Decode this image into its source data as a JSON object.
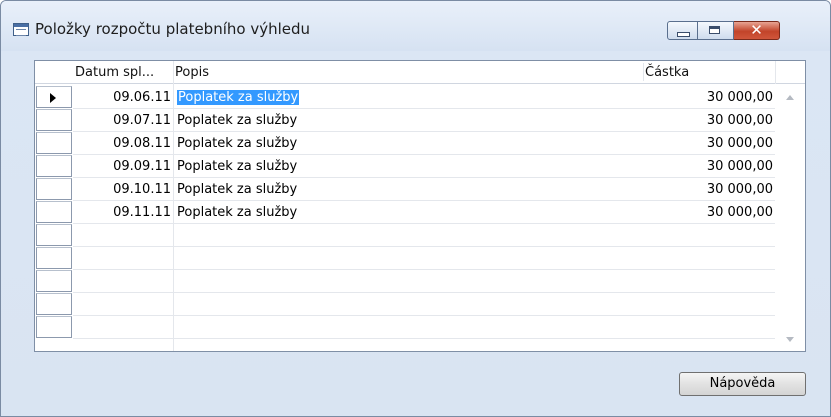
{
  "window": {
    "title": "Položky rozpočtu platebního výhledu"
  },
  "grid": {
    "columns": [
      "Datum spl...",
      "Popis",
      "Částka"
    ],
    "rows": [
      {
        "date": "09.06.11",
        "desc": "Poplatek za služby",
        "amount": "30 000,00"
      },
      {
        "date": "09.07.11",
        "desc": "Poplatek za služby",
        "amount": "30 000,00"
      },
      {
        "date": "09.08.11",
        "desc": "Poplatek za služby",
        "amount": "30 000,00"
      },
      {
        "date": "09.09.11",
        "desc": "Poplatek za služby",
        "amount": "30 000,00"
      },
      {
        "date": "09.10.11",
        "desc": "Poplatek za služby",
        "amount": "30 000,00"
      },
      {
        "date": "09.11.11",
        "desc": "Poplatek za služby",
        "amount": "30 000,00"
      }
    ],
    "empty_rows": 5,
    "selected_row": 0
  },
  "buttons": {
    "help": "Nápověda"
  },
  "icons": {
    "window": "list-window-icon",
    "minimize": "minimize-icon",
    "maximize": "maximize-icon",
    "close": "close-icon",
    "row_pointer": "row-pointer-icon",
    "scroll_up": "scroll-up-icon",
    "scroll_down": "scroll-down-icon"
  },
  "colors": {
    "selection": "#3399ff",
    "close_button": "#c2442a"
  }
}
